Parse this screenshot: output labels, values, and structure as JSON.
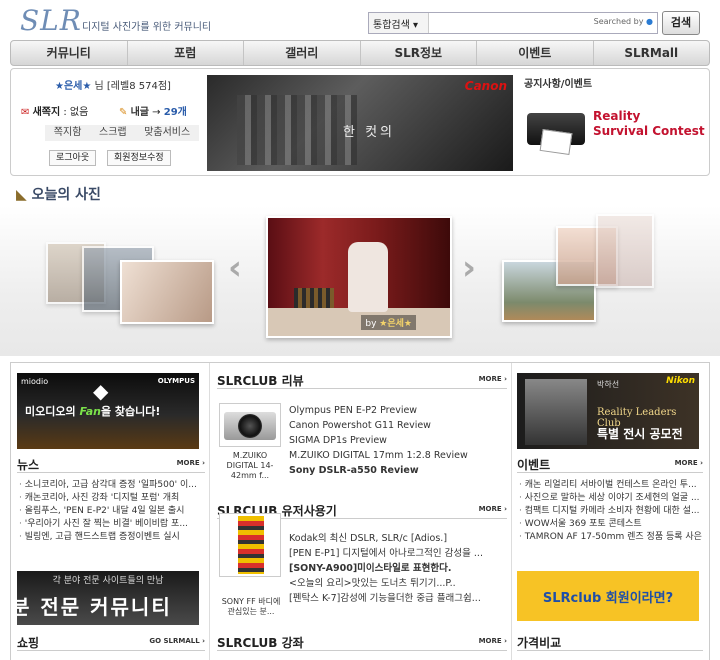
{
  "header": {
    "logo": "SLR",
    "tagline": "디지털 사진가를 위한 커뮤니티",
    "search_scope": "통합검색",
    "search_by": "Searched by",
    "search_button": "검색"
  },
  "nav": [
    "커뮤니티",
    "포럼",
    "갤러리",
    "SLR정보",
    "이벤트",
    "SLRMall"
  ],
  "user": {
    "name": "★은세★",
    "suffix": "님 [레벨8  574점]",
    "messages_label": "새쪽지",
    "messages_value": "없음",
    "posts_label": "내글",
    "posts_value": "29개",
    "links": [
      "쪽지함",
      "스크랩",
      "맞춤서비스"
    ],
    "logout": "로그아웃",
    "profile": "회원정보수정"
  },
  "banner": {
    "brand": "Canon",
    "text": "한 컷의"
  },
  "notice": {
    "title": "공지사항/이벤트",
    "contest_line1": "Reality",
    "contest_line2": "Survival Contest"
  },
  "today": {
    "title": "오늘의 사진",
    "photo_by_prefix": "by",
    "photo_author": "★은세★"
  },
  "left": {
    "ad_brand": "miodio",
    "ad_partner": "OLYMPUS",
    "ad_text_a": "미오디오의 ",
    "ad_text_fan": "Fan",
    "ad_text_b": "을 찾습니다!",
    "news_title": "뉴스",
    "news_more": "MORE ›",
    "news": [
      "소니코리아, 고급 삼각대 증정 '일파500' 이...",
      "캐논코리아, 사진 강좌 '디지털 포럼' 개최",
      "올림푸스, 'PEN E-P2' 내달 4일 일본 출시",
      "'우리아기 사진 잘 찍는 비결' 베이비랍 포...",
      "빌링엔, 고급 핸드스트랩 증정이벤트 실시"
    ],
    "ad2_small": "각 분야 전문 사이트들의 만남",
    "ad2_big": "분 전문 커뮤니티",
    "shop_title": "쇼핑",
    "shop_more": "GO SLRMALL ›"
  },
  "middle": {
    "review_title": "SLRCLUB 리뷰",
    "review_more": "MORE ›",
    "review_caption": "M.ZUIKO DIGITAL 14-42mm f...",
    "reviews": [
      "Olympus PEN E-P2 Preview",
      "Canon Powershot G11 Review",
      "SIGMA DP1s Preview",
      "M.ZUIKO DIGITAL 17mm 1:2.8 Review",
      "Sony DSLR-a550 Review"
    ],
    "user_title": "SLRCLUB 유저사용기",
    "user_more": "MORE ›",
    "user_caption": "SONY FF 바디에 관심있는 분...",
    "user_reviews": [
      "Kodak의 최신 DSLR, SLR/c [Adios.]",
      "[PEN E-P1] 디지털에서 아나로그적인 감성을 ...",
      "[SONY-A900]미이스타일로 표현한다.",
      "<오늘의 요리>맛있는 도너츠 튀기기...P..",
      "[펜탁스 K-7]감성에 기능을더한 중급 플래그쉽..."
    ],
    "lecture_title": "SLRCLUB 강좌",
    "lecture_more": "MORE ›"
  },
  "right": {
    "ad_brand": "Nikon",
    "ad_name": "박하선",
    "ad_caption1": "Reality Leaders Club",
    "ad_caption2": "특별 전시 공모전",
    "event_title": "이벤트",
    "event_more": "MORE ›",
    "events": [
      "캐논 리얼리티 서바이벌 컨테스트 온라인 투...",
      "사진으로 말하는 세상 이야기 조세현의 얼굴 ...",
      "컴팩트 디지털 카메라 소비자 현황에 대한 설...",
      "WOW서울 369 포토 콘테스트",
      "TAMRON AF 17-50mm 렌즈 정품 등록 사은 ..."
    ],
    "ad2_text": "SLRclub 회원이라면?",
    "price_title": "가격비교"
  }
}
